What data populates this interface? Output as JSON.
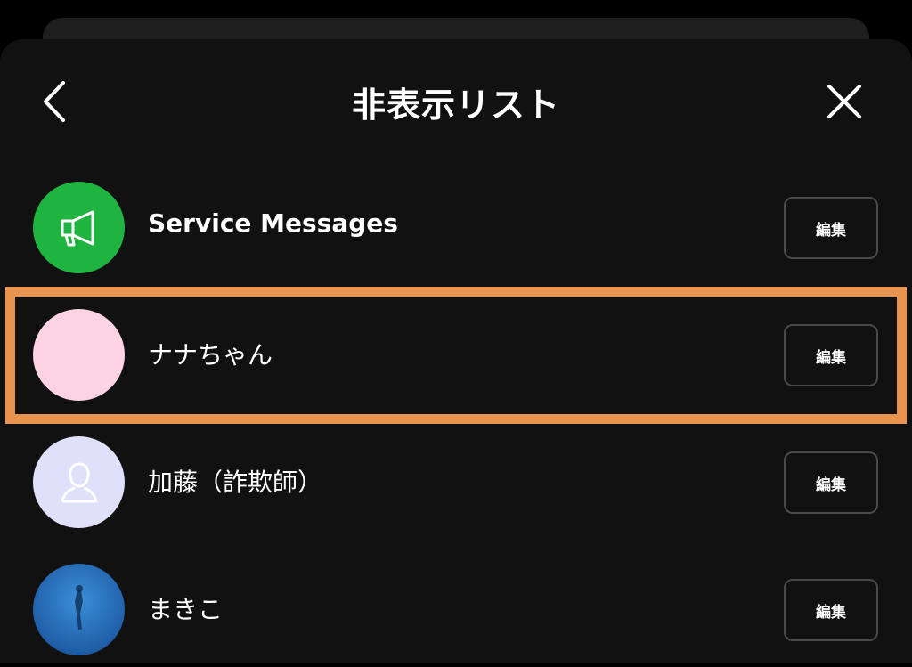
{
  "header": {
    "title": "非表示リスト",
    "back_icon": "chevron-left-icon",
    "close_icon": "close-icon"
  },
  "rows": [
    {
      "name": "Service Messages",
      "edit_label": "編集",
      "avatar_color": "#1fb33f",
      "avatar_icon": "megaphone-icon"
    },
    {
      "name": "ナナちゃん",
      "edit_label": "編集",
      "avatar_color": "#fdd3e4",
      "avatar_icon": ""
    },
    {
      "name": "加藤（詐欺師）",
      "edit_label": "編集",
      "avatar_color": "#dfe0fa",
      "avatar_icon": "person-icon"
    },
    {
      "name": "まきこ",
      "edit_label": "編集",
      "avatar_color": "#2a78c2",
      "avatar_icon": "photo-avatar"
    }
  ],
  "colors": {
    "background": "#111111",
    "highlight": "#e8934e",
    "text": "#ffffff",
    "edit_border": "#4a4a4a"
  }
}
